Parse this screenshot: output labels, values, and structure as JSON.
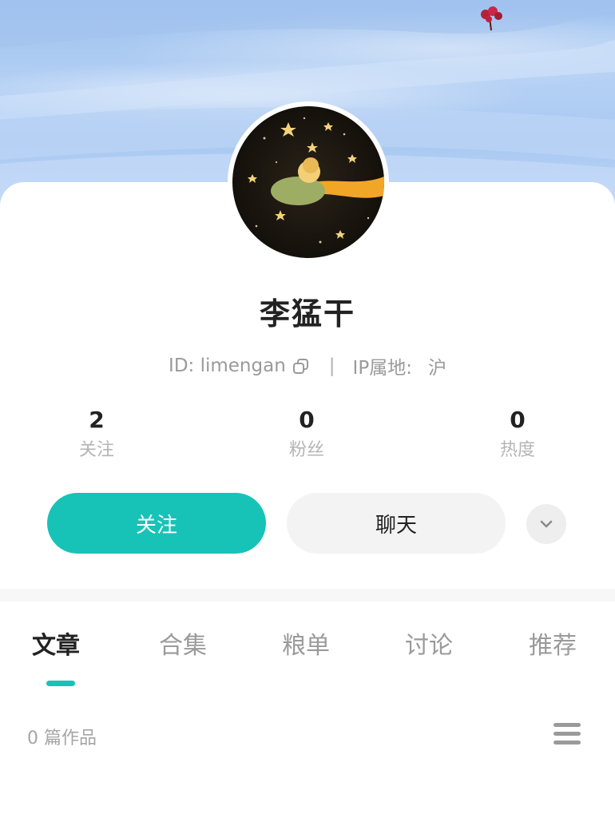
{
  "profile": {
    "name": "李猛干",
    "id_label": "ID: limengan",
    "ip_label": "IP属地:",
    "ip_value": "沪"
  },
  "stats": [
    {
      "value": "2",
      "label": "关注"
    },
    {
      "value": "0",
      "label": "粉丝"
    },
    {
      "value": "0",
      "label": "热度"
    }
  ],
  "actions": {
    "follow_label": "关注",
    "chat_label": "聊天"
  },
  "tabs": [
    {
      "label": "文章",
      "active": true
    },
    {
      "label": "合集",
      "active": false
    },
    {
      "label": "粮单",
      "active": false
    },
    {
      "label": "讨论",
      "active": false
    },
    {
      "label": "推荐",
      "active": false
    }
  ],
  "works": {
    "count_label": "0 篇作品"
  },
  "colors": {
    "accent": "#17c3b7",
    "banner_sky": "#a9c9f2",
    "text_primary": "#222222",
    "text_muted": "#9a9a9a"
  },
  "icons": {
    "copy": "copy-icon",
    "more": "chevron-down-icon",
    "list": "menu-icon"
  }
}
